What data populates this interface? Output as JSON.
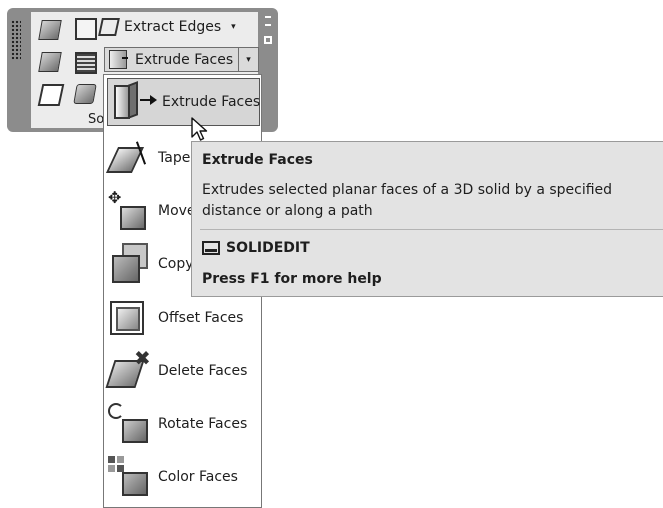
{
  "ribbon": {
    "extract_edges_label": "Extract Edges",
    "extract_edges_arrow": "▾",
    "extrude_faces_label": "Extrude Faces",
    "extrude_faces_arrow": "▾",
    "panel_title": "So"
  },
  "dropdown": {
    "items": [
      {
        "label": "Extrude Faces",
        "icon": "extrude-faces-icon",
        "active": true
      },
      {
        "label": "Tape",
        "icon": "taper-faces-icon"
      },
      {
        "label": "Move",
        "icon": "move-faces-icon"
      },
      {
        "label": "Copy",
        "icon": "copy-faces-icon"
      },
      {
        "label": "Offset Faces",
        "icon": "offset-faces-icon"
      },
      {
        "label": "Delete Faces",
        "icon": "delete-faces-icon"
      },
      {
        "label": "Rotate Faces",
        "icon": "rotate-faces-icon"
      },
      {
        "label": "Color Faces",
        "icon": "color-faces-icon"
      }
    ]
  },
  "tooltip": {
    "title": "Extrude Faces",
    "description": "Extrudes selected planar faces of a 3D solid by a specified distance or along a path",
    "command": "SOLIDEDIT",
    "help": "Press F1 for more help"
  }
}
